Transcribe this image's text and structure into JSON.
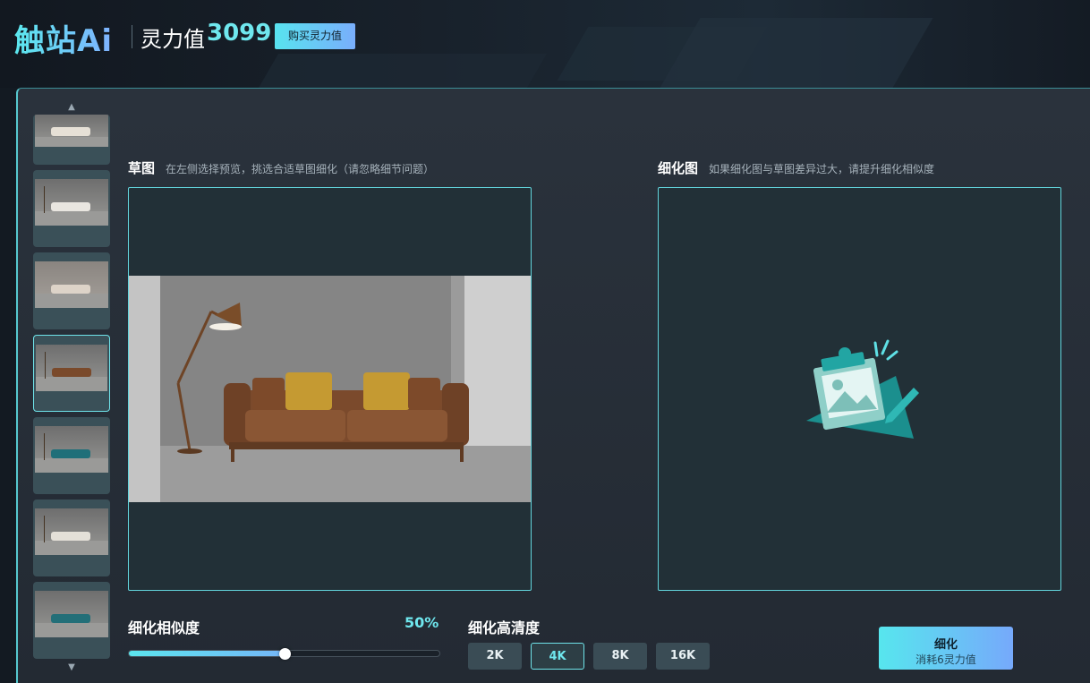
{
  "header": {
    "logo": "触站Ai",
    "points_label": "灵力值",
    "points_value": "3099",
    "buy_button": "购买灵力值"
  },
  "thumbnails": {
    "count": 7,
    "selected_index": 3
  },
  "sketch": {
    "title": "草图",
    "hint": "在左侧选择预览，挑选合适草图细化（请忽略细节问题）"
  },
  "refined": {
    "title": "细化图",
    "hint": "如果细化图与草图差异过大，请提升细化相似度"
  },
  "similarity": {
    "label": "细化相似度",
    "value": "50%",
    "fraction": 0.5
  },
  "resolution": {
    "label": "细化高清度",
    "options": [
      "2K",
      "4K",
      "8K",
      "16K"
    ],
    "selected": "4K"
  },
  "refine_button": {
    "label": "细化",
    "cost": "消耗6灵力值"
  },
  "colors": {
    "accent": "#6fe7ee",
    "accent_gradient_end": "#76a9fb",
    "panel_bg": "#262e37"
  }
}
